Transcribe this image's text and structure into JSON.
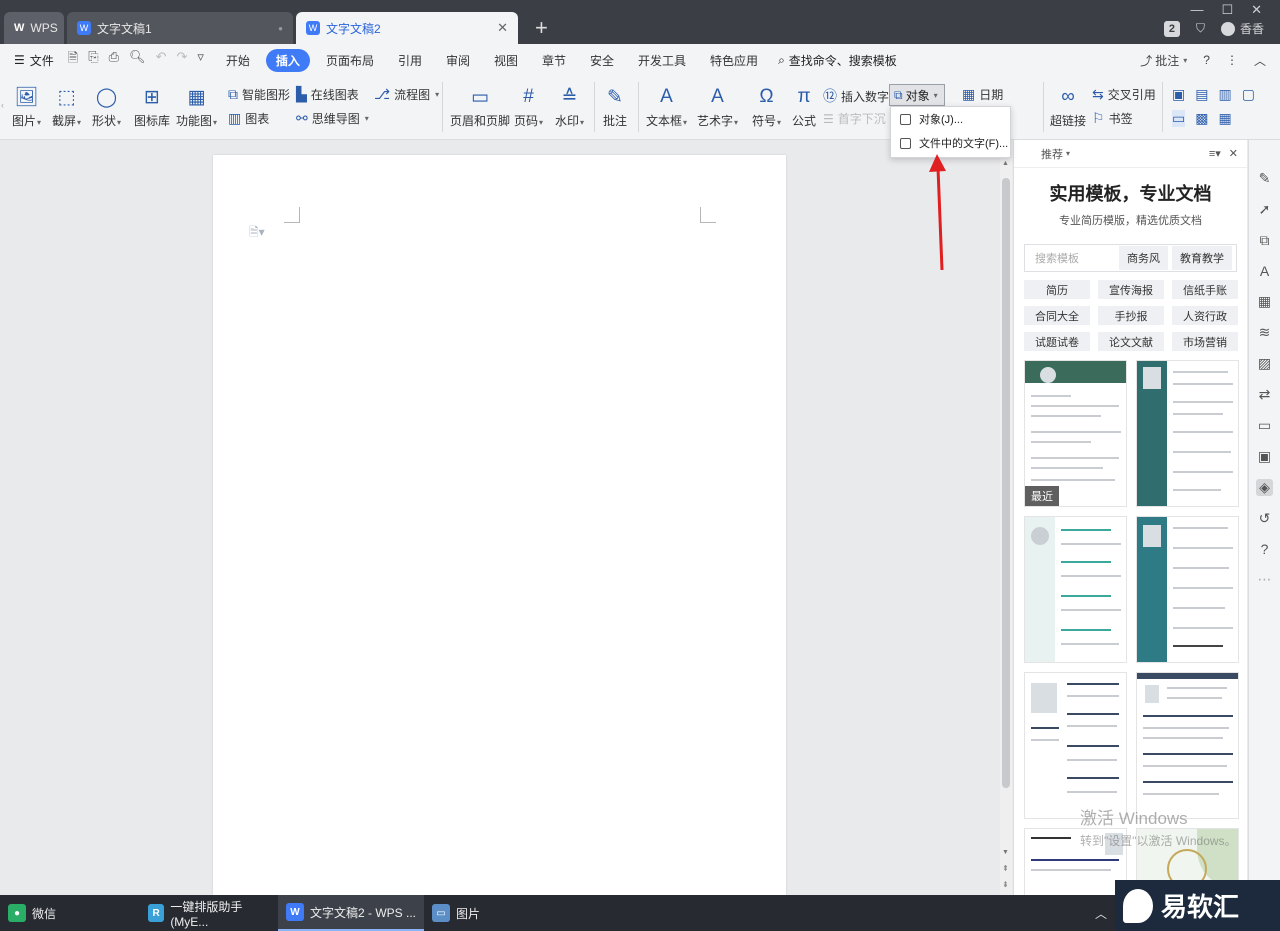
{
  "tabs": {
    "wps": "WPS",
    "doc1": "文字文稿1",
    "doc1_mark": "●",
    "doc2": "文字文稿2",
    "doc2_close": "✕",
    "add": "+",
    "badge": "2",
    "user": "香香"
  },
  "menu": {
    "file": "文件",
    "items": [
      "开始",
      "插入",
      "页面布局",
      "引用",
      "审阅",
      "视图",
      "章节",
      "安全",
      "开发工具",
      "特色应用"
    ],
    "search": "查找命令、搜索模板",
    "comment": "批注",
    "help": "?"
  },
  "ribbon": {
    "picture": "图片",
    "screenshot": "截屏",
    "shape": "形状",
    "iconlib": "图标库",
    "funcchart": "功能图",
    "smartart": "智能图形",
    "chart": "图表",
    "onlinechart": "在线图表",
    "mindmap": "思维导图",
    "flowchart": "流程图",
    "header_footer": "页眉和页脚",
    "pagenum": "页码",
    "watermark": "水印",
    "comment": "批注",
    "textbox": "文本框",
    "wordart": "艺术字",
    "symbol": "符号",
    "formula": "公式",
    "insert_number": "插入数字",
    "dropcap": "首字下沉",
    "object": "对象",
    "date": "日期",
    "hyperlink": "超链接",
    "crossref": "交叉引用",
    "bookmark": "书签"
  },
  "object_menu": {
    "item1": "对象(J)...",
    "item2": "文件中的文字(F)..."
  },
  "panel": {
    "header": "推荐",
    "title": "实用模板，专业文档",
    "subtitle": "专业简历模版，精选优质文档",
    "search_placeholder": "搜索模板",
    "search_chips": [
      "商务风",
      "教育教学"
    ],
    "categories": [
      "简历",
      "宣传海报",
      "信纸手账",
      "合同大全",
      "手抄报",
      "人资行政",
      "试题试卷",
      "论文文献",
      "市场营销"
    ],
    "recent_label": "最近"
  },
  "activate": {
    "line1": "激活 Windows",
    "line2": "转到\"设置\"以激活 Windows。"
  },
  "taskbar": {
    "wechat": "微信",
    "typeset": "一键排版助手(MyE...",
    "wps": "文字文稿2 - WPS ...",
    "pictures": "图片"
  },
  "brand": "易软汇",
  "colors": {
    "accent": "#3f7bf6",
    "arrow": "#e02020"
  }
}
